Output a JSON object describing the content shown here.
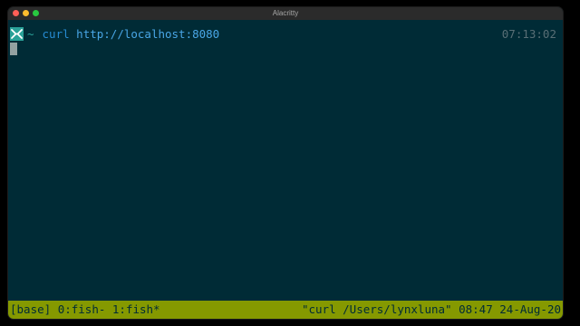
{
  "window": {
    "title": "Alacritty"
  },
  "terminal": {
    "prompt_symbol": "~",
    "command": "curl",
    "argument": "http://localhost:8080",
    "clock": "07:13:02"
  },
  "tmux": {
    "session": "[base]",
    "windows": [
      {
        "label": "0:fish-"
      },
      {
        "label": "1:fish*"
      }
    ],
    "pane_title": "\"curl /Users/lynxluna\"",
    "time": "08:47",
    "date": "24-Aug-20"
  },
  "colors": {
    "background": "#002b36",
    "status_bar": "#859900",
    "prompt_accent": "#2aa198",
    "command": "#268bd2"
  },
  "icons": {
    "prompt_logo": "fish-logo-icon"
  }
}
